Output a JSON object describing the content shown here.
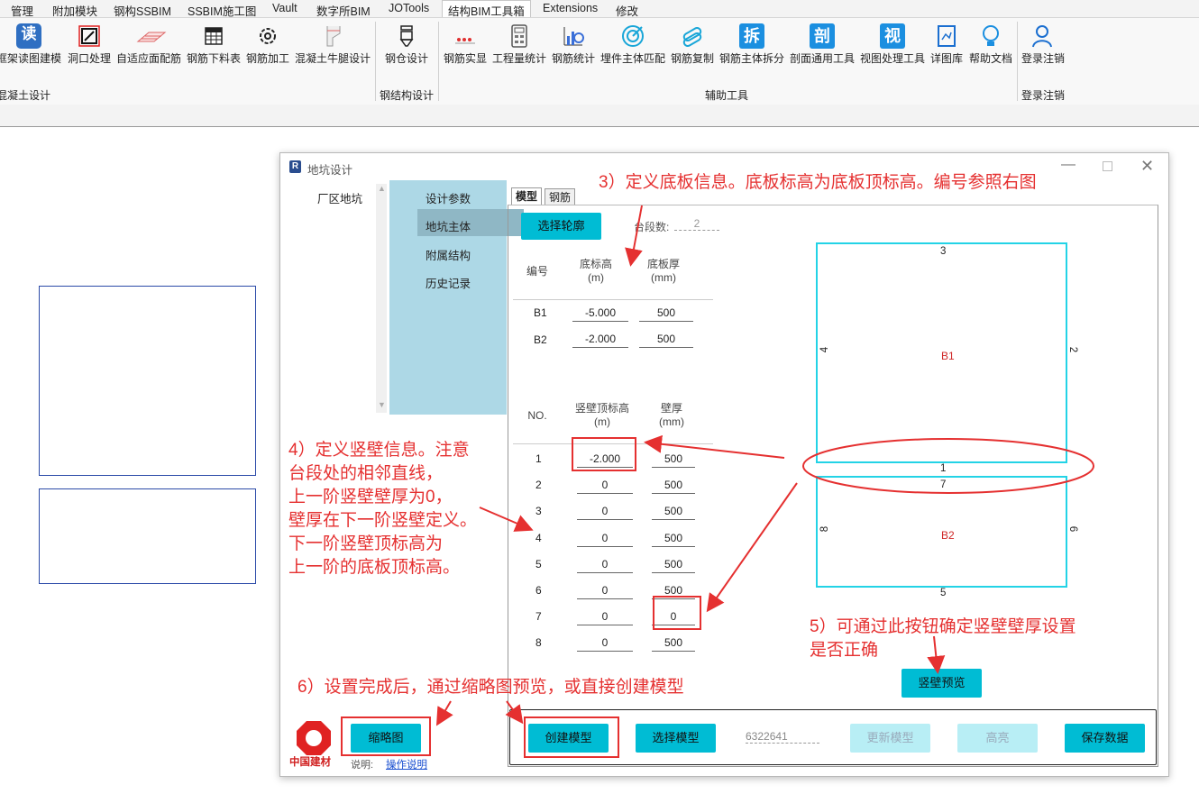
{
  "menubar": {
    "items": [
      "管理",
      "附加模块",
      "钢构SSBIM",
      "SSBIM施工图",
      "Vault",
      "数字所BIM",
      "JOTools",
      "结构BIM工具箱",
      "Extensions",
      "修改"
    ],
    "active": "结构BIM工具箱"
  },
  "ribbon": {
    "concrete": [
      "框架读图建模",
      "洞口处理",
      "自适应面配筋",
      "钢筋下料表",
      "钢筋加工",
      "混凝土牛腿设计"
    ],
    "steel": [
      "钢仓设计"
    ],
    "aux": [
      "钢筋实显",
      "工程量统计",
      "钢筋统计",
      "埋件主体匹配",
      "钢筋复制",
      "钢筋主体拆分",
      "剖面通用工具",
      "视图处理工具",
      "详图库",
      "帮助文档"
    ],
    "login": [
      "登录注销"
    ],
    "groups": {
      "concrete": "混凝土设计",
      "steel": "钢结构设计",
      "aux": "辅助工具",
      "login": "登录注销"
    },
    "glyph_chars": {
      "du": "读",
      "chai": "拆",
      "pou": "剖",
      "shi": "视"
    }
  },
  "dialog": {
    "title": "地坑设计",
    "nav1": [
      "厂区地坑"
    ],
    "nav2": [
      "设计参数",
      "地坑主体",
      "附属结构",
      "历史记录"
    ],
    "nav2_selected": 1,
    "tabs": [
      "模型",
      "钢筋"
    ],
    "select_contour": "选择轮廓",
    "step_count_label": "台段数:",
    "step_count": "2",
    "slab_headers": {
      "id": "编号",
      "elev": "底标高\n(m)",
      "thick": "底板厚\n(mm)"
    },
    "slabs": [
      {
        "id": "B1",
        "elev": "-5.000",
        "thick": "500"
      },
      {
        "id": "B2",
        "elev": "-2.000",
        "thick": "500"
      }
    ],
    "wall_headers": {
      "no": "NO.",
      "top": "竖壁顶标高\n(m)",
      "thick": "壁厚\n(mm)"
    },
    "walls": [
      {
        "no": "1",
        "top": "-2.000",
        "thick": "500"
      },
      {
        "no": "2",
        "top": "0",
        "thick": "500"
      },
      {
        "no": "3",
        "top": "0",
        "thick": "500"
      },
      {
        "no": "4",
        "top": "0",
        "thick": "500"
      },
      {
        "no": "5",
        "top": "0",
        "thick": "500"
      },
      {
        "no": "6",
        "top": "0",
        "thick": "500"
      },
      {
        "no": "7",
        "top": "0",
        "thick": "0"
      },
      {
        "no": "8",
        "top": "0",
        "thick": "500"
      }
    ],
    "diagram": {
      "upper": {
        "top": "3",
        "left": "4",
        "right": "2",
        "bottom": "1",
        "center": "B1"
      },
      "lower": {
        "top": "7",
        "left": "8",
        "right": "6",
        "bottom": "5",
        "center": "B2"
      }
    },
    "wall_preview": "竖壁预览",
    "thumbnail": "缩略图",
    "create_model": "创建模型",
    "select_model": "选择模型",
    "model_id": "6322641",
    "update_model": "更新模型",
    "highlight": "高亮",
    "save_data": "保存数据",
    "logo_text": "中国建材",
    "help_label": "说明:",
    "help_link": "操作说明"
  },
  "annotations": {
    "a3": "3）定义底板信息。底板标高为底板顶标高。编号参照右图",
    "a4": [
      "4）定义竖壁信息。注意",
      "台段处的相邻直线，",
      "上一阶竖壁壁厚为0，",
      "壁厚在下一阶竖壁定义。",
      "下一阶竖壁顶标高为",
      "上一阶的底板顶标高。"
    ],
    "a5": [
      "5）可通过此按钮确定竖壁壁厚设置",
      "是否正确"
    ],
    "a6": "6）设置完成后，通过缩略图预览，或直接创建模型"
  },
  "colors": {
    "accent_cyan": "#00bcd4",
    "annotation_red": "#e53030",
    "nav_blue": "#add8e6",
    "diagram_cyan": "#23d3e6"
  }
}
